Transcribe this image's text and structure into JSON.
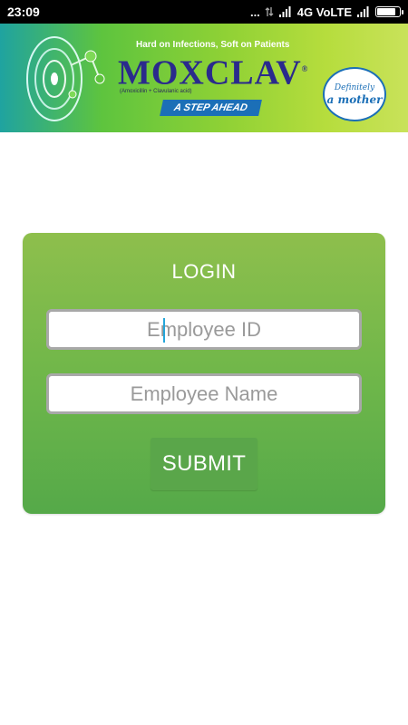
{
  "status_bar": {
    "time": "23:09",
    "dots": "...",
    "network": "4G VoLTE",
    "battery_level": 0.85,
    "icons": [
      "data-transfer-icon",
      "signal-icon",
      "signal-icon",
      "battery-icon"
    ]
  },
  "banner": {
    "tagline": "Hard on Infections, Soft on Patients",
    "brand": "MOXCLAV",
    "brand_mark": "®",
    "generic": "(Amoxicillin + Clavulanic acid)",
    "slogan": "A STEP AHEAD",
    "badge_line1": "Definitely",
    "badge_line2": "a mother",
    "colors": {
      "brand": "#2a2a8c",
      "slogan_bg": "#1b6fb7"
    }
  },
  "login": {
    "title": "LOGIN",
    "employee_id_placeholder": "Employee ID",
    "employee_name_placeholder": "Employee Name",
    "submit_label": "SUBMIT",
    "colors": {
      "card": "#6db64a",
      "button": "#5aa64a"
    }
  }
}
